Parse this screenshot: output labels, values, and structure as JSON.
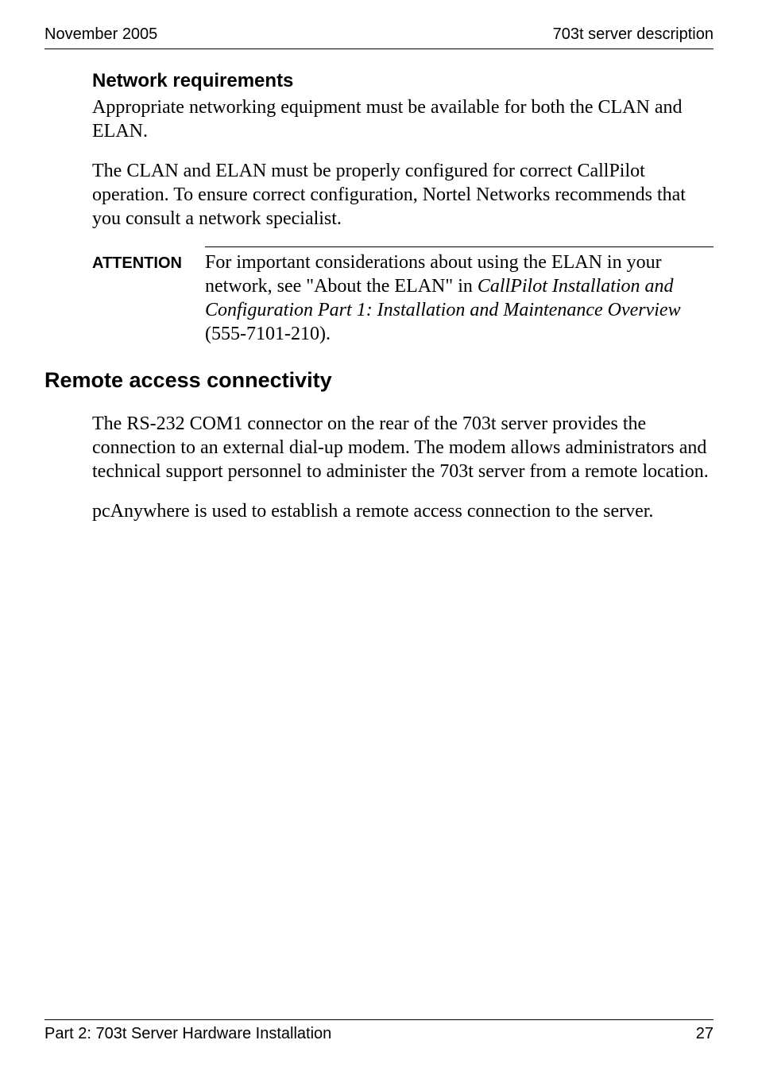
{
  "header": {
    "left": "November 2005",
    "right": "703t server description"
  },
  "section1": {
    "heading": "Network requirements",
    "para1": "Appropriate networking equipment must be available for both the CLAN and ELAN.",
    "para2": "The CLAN and ELAN must be properly configured for correct CallPilot operation. To ensure correct configuration, Nortel Networks recommends that you consult a network specialist."
  },
  "attention": {
    "label": "ATTENTION",
    "body_pre": "For important considerations about using the ELAN in your network, see \"About the ELAN\" in ",
    "body_italic": "CallPilot Installation and Configuration Part 1: Installation and Maintenance Overview",
    "body_post": " (555-7101-210)."
  },
  "section2": {
    "heading": "Remote access connectivity",
    "para1": "The RS-232 COM1 connector on the rear of the 703t server provides the connection to an external dial-up modem. The modem allows administrators and technical support personnel to administer the 703t server from a remote location.",
    "para2": "pcAnywhere is used to establish a remote access connection to the server."
  },
  "footer": {
    "left": "Part 2: 703t Server Hardware Installation",
    "right": "27"
  }
}
